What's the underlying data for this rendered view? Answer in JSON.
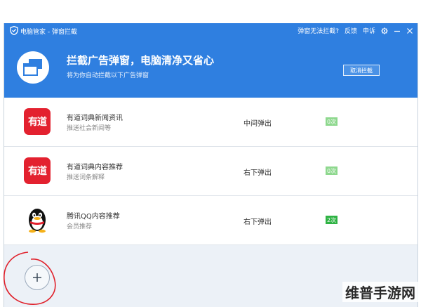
{
  "titlebar": {
    "app_title": "电脑管家 - 弹窗拦截",
    "cannot_block": "弹窗无法拦截?",
    "feedback": "反馈",
    "appeal": "申诉"
  },
  "header": {
    "title": "拦截广告弹窗，电脑清净又省心",
    "subtitle": "将为你自动拦截以下广告弹窗",
    "cancel_button": "取消拦截"
  },
  "rows": [
    {
      "name": "有道词典新闻资讯",
      "desc": "推送社会新闻等",
      "position": "中间弹出",
      "count": "0次",
      "logo": "youdao",
      "logo_text": "有道",
      "count_color": "#8ed88e"
    },
    {
      "name": "有道词典内容推荐",
      "desc": "推送词条解释",
      "position": "右下弹出",
      "count": "0次",
      "logo": "youdao",
      "logo_text": "有道",
      "count_color": "#8ed88e"
    },
    {
      "name": "腾讯QQ内容推荐",
      "desc": "会员推荐",
      "position": "右下弹出",
      "count": "2次",
      "logo": "qq-penguin-icon",
      "count_color": "#2fb344"
    }
  ],
  "watermark": "维普手游网",
  "colors": {
    "header_blue": "#2f7fe0",
    "youdao_red": "#e3212f",
    "count_light_green": "#8ed88e",
    "count_green": "#2fb344",
    "annotation_red": "#e0202a"
  }
}
